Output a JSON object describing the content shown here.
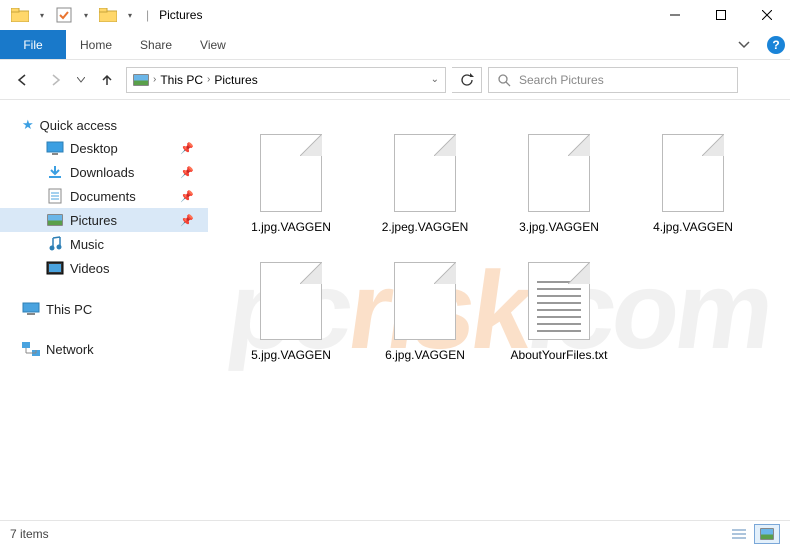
{
  "window": {
    "title": "Pictures"
  },
  "ribbon": {
    "file": "File",
    "tabs": [
      "Home",
      "Share",
      "View"
    ]
  },
  "breadcrumb": {
    "items": [
      "This PC",
      "Pictures"
    ]
  },
  "search": {
    "placeholder": "Search Pictures"
  },
  "sidebar": {
    "quick_access": {
      "label": "Quick access",
      "items": [
        {
          "label": "Desktop",
          "icon": "desktop",
          "pinned": true
        },
        {
          "label": "Downloads",
          "icon": "downloads",
          "pinned": true
        },
        {
          "label": "Documents",
          "icon": "documents",
          "pinned": true
        },
        {
          "label": "Pictures",
          "icon": "pictures",
          "pinned": true,
          "selected": true
        },
        {
          "label": "Music",
          "icon": "music",
          "pinned": false
        },
        {
          "label": "Videos",
          "icon": "videos",
          "pinned": false
        }
      ]
    },
    "this_pc": {
      "label": "This PC"
    },
    "network": {
      "label": "Network"
    }
  },
  "files": [
    {
      "name": "1.jpg.VAGGEN",
      "type": "blank"
    },
    {
      "name": "2.jpeg.VAGGEN",
      "type": "blank"
    },
    {
      "name": "3.jpg.VAGGEN",
      "type": "blank"
    },
    {
      "name": "4.jpg.VAGGEN",
      "type": "blank"
    },
    {
      "name": "5.jpg.VAGGEN",
      "type": "blank"
    },
    {
      "name": "6.jpg.VAGGEN",
      "type": "blank"
    },
    {
      "name": "AboutYourFiles.txt",
      "type": "text"
    }
  ],
  "statusbar": {
    "count": "7 items"
  }
}
